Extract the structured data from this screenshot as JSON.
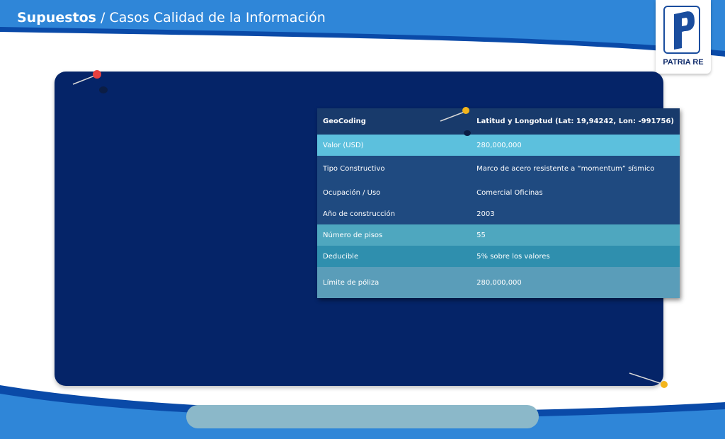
{
  "header": {
    "title_bold": "Supuestos",
    "title_rest": " / Casos Calidad de la Información"
  },
  "logo": {
    "text": "PATRIA RE"
  },
  "colors": {
    "header_blue": "#2f86d8",
    "card_navy": "#052468",
    "table_header": "#183a6b",
    "row_light_blue": "#5cc0dd",
    "row_dark_blue": "#1f4a80",
    "row_teal": "#4ea7bf",
    "row_deep_teal": "#2f8fae",
    "row_last": "#5a9db9",
    "pin_red": "#e8403f",
    "pin_yellow": "#f3b51c",
    "pill": "#8bb8c9"
  },
  "table": {
    "header": {
      "label": "GeoCoding",
      "value": "Latitud y Longotud  (Lat: 19,94242, Lon: -991756)"
    },
    "rows": [
      {
        "label": "Valor (USD)",
        "value": "280,000,000"
      },
      {
        "label": "Tipo Constructivo",
        "value": "Marco de acero resistente a “momentum” sísmico"
      },
      {
        "label": "Ocupación / Uso",
        "value": "Comercial Oficinas"
      },
      {
        "label": "Año de construcción",
        "value": "2003"
      },
      {
        "label": "Número de pisos",
        "value": "55"
      },
      {
        "label": "Deducible",
        "value": "5% sobre los valores"
      },
      {
        "label": "Límite de póliza",
        "value": "280,000,000"
      }
    ]
  }
}
